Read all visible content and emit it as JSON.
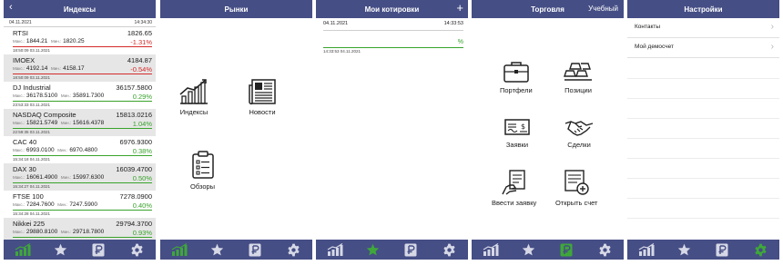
{
  "screen1": {
    "title": "Индексы",
    "back_icon": "chevron-left-icon",
    "date": "04.11.2021",
    "time": "14:34:30",
    "max_label": "Макс.:",
    "min_label": "Мин.:",
    "rows": [
      {
        "name": "RTSI",
        "last": "1826.65",
        "max": "1844.21",
        "min": "1820.25",
        "change": "-1.31%",
        "dir": "down",
        "ts": "18:50:09 03.11.2021",
        "alt": false
      },
      {
        "name": "IMOEX",
        "last": "4184.87",
        "max": "4192.14",
        "min": "4158.17",
        "change": "-0.54%",
        "dir": "down",
        "ts": "18:50:09 03.11.2021",
        "alt": true
      },
      {
        "name": "DJ Industrial",
        "last": "36157.5800",
        "max": "36178.5100",
        "min": "35891.7300",
        "change": "0.29%",
        "dir": "up",
        "ts": "23:53:33 03.11.2021",
        "alt": false
      },
      {
        "name": "NASDAQ Composite",
        "last": "15813.0216",
        "max": "15821.5749",
        "min": "15616.4378",
        "change": "1.04%",
        "dir": "up",
        "ts": "22:59:35 03.11.2021",
        "alt": true
      },
      {
        "name": "CAC 40",
        "last": "6976.9300",
        "max": "6993.0100",
        "min": "6970.4800",
        "change": "0.38%",
        "dir": "up",
        "ts": "15:34:18 04.11.2021",
        "alt": false
      },
      {
        "name": "DAX 30",
        "last": "16039.4700",
        "max": "16061.4900",
        "min": "15997.6300",
        "change": "0.50%",
        "dir": "up",
        "ts": "15:34:27 04.11.2021",
        "alt": true
      },
      {
        "name": "FTSE 100",
        "last": "7278.0900",
        "max": "7284.7600",
        "min": "7247.5900",
        "change": "0.40%",
        "dir": "up",
        "ts": "15:34:28 04.11.2021",
        "alt": false
      },
      {
        "name": "Nikkei 225",
        "last": "29794.3700",
        "max": "29880.8100",
        "min": "29718.7800",
        "change": "0.93%",
        "dir": "up",
        "ts": "",
        "alt": true
      }
    ]
  },
  "screen2": {
    "title": "Рынки",
    "items": [
      {
        "label": "Индексы",
        "icon": "chart-growth-icon"
      },
      {
        "label": "Новости",
        "icon": "newspaper-icon"
      },
      {
        "label": "Обзоры",
        "icon": "clipboard-list-icon"
      }
    ]
  },
  "screen3": {
    "title": "Мои котировки",
    "add_icon": "plus-icon",
    "date": "04.11.2021",
    "time": "14:33:53",
    "change": "%",
    "ts": "14:33:53 04.11.2021"
  },
  "screen4": {
    "title": "Торговля",
    "mode": "Учебный",
    "items": [
      {
        "label": "Портфели",
        "icon": "briefcase-icon"
      },
      {
        "label": "Позиции",
        "icon": "gold-bars-icon"
      },
      {
        "label": "Заявки",
        "icon": "cheque-icon"
      },
      {
        "label": "Сделки",
        "icon": "handshake-icon"
      },
      {
        "label": "Ввести заявку",
        "icon": "hand-form-icon"
      },
      {
        "label": "Открыть счет",
        "icon": "open-account-icon"
      }
    ]
  },
  "screen5": {
    "title": "Настройки",
    "items": [
      {
        "label": "Контакты"
      },
      {
        "label": "Мой демосчет"
      }
    ]
  },
  "tabbar": {
    "icons": [
      "chart-icon",
      "star-icon",
      "ruble-icon",
      "gear-icon"
    ]
  },
  "colors": {
    "header": "#454e85",
    "active_tab": "#3fa73a",
    "inactive_tab": "#d6d8e6",
    "up": "#38a22b",
    "down": "#d42a2a",
    "alt_row": "#e6e6e6"
  }
}
